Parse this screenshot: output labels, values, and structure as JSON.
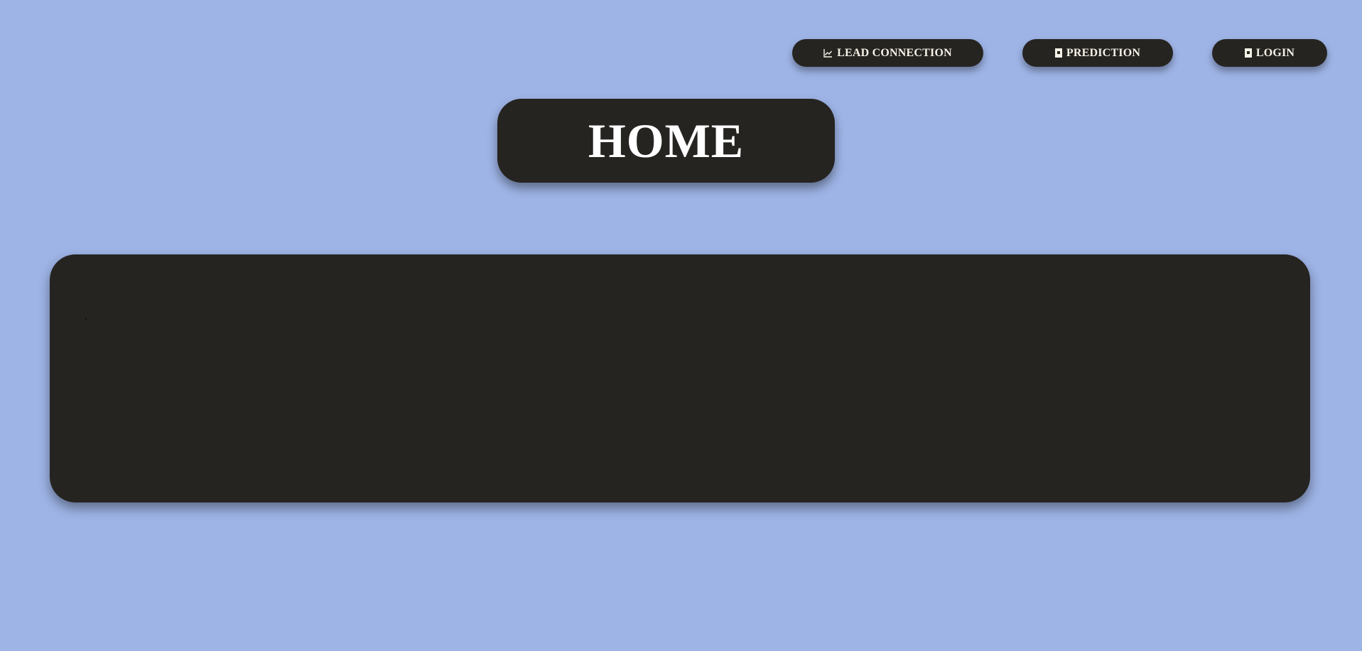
{
  "nav": {
    "lead_connection": {
      "label": "LEAD CONNECTION",
      "icon": "chart-line-icon"
    },
    "prediction": {
      "label": "PREDICTION",
      "icon": "document-icon"
    },
    "login": {
      "label": "LOGIN",
      "icon": "document-icon"
    }
  },
  "header": {
    "title": "HOME"
  },
  "colors": {
    "background": "#9eb4e6",
    "panel": "#262421",
    "text": "#ffffff"
  }
}
